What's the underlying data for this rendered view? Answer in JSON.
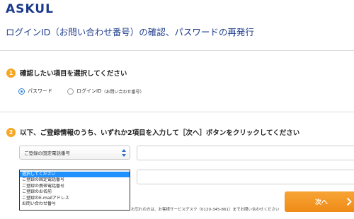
{
  "header": {
    "logo_text": "ASKUL"
  },
  "page": {
    "title": "ログインID（お問い合わせ番号）の確認、パスワードの再発行"
  },
  "steps": [
    {
      "number": "1",
      "text": "確認したい項目を選択してください"
    },
    {
      "number": "2",
      "text": "以下、ご登録情報のうち、いずれか2項目を入力して［次へ］ボタンをクリックしてください"
    }
  ],
  "options": {
    "password": {
      "label": "パスワード",
      "checked": true
    },
    "login_id": {
      "label": "ログインID",
      "sub": "（お問い合わせ番号）",
      "checked": false
    }
  },
  "fields": {
    "select1_value": "ご登録の固定電話番号",
    "dropdown_options": [
      "選択してください",
      "ご登録の固定電話番号",
      "ご登録の携帯電話番号",
      "ご登録のお名前",
      "ご登録のE-mailアドレス",
      "お問い合わせ番号"
    ],
    "dropdown_selected_index": 0
  },
  "footnote": "お忘れの方は、お客様サービスデスク（0120-345-861）までお問い合わせください",
  "buttons": {
    "next_label": "次へ"
  },
  "colors": {
    "brand": "#1a3a8c",
    "accent": "#f5a623",
    "selection": "#1e90ff",
    "radio_active": "#2f7fd6"
  }
}
